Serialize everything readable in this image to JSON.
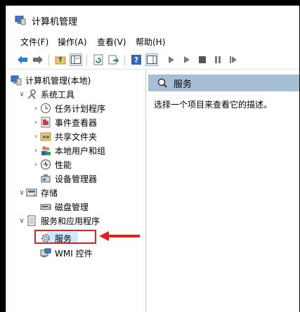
{
  "window": {
    "title": "计算机管理"
  },
  "menu": [
    "文件(F)",
    "操作(A)",
    "查看(V)",
    "帮助(H)"
  ],
  "toolbar": {
    "icons": [
      "back-icon",
      "forward-icon",
      "up-folder-icon",
      "show-hide-tree-icon",
      "refresh-icon",
      "export-icon",
      "help-icon",
      "properties-icon",
      "play-icon",
      "play-alt-icon",
      "stop-icon",
      "pause-icon",
      "restart-icon"
    ]
  },
  "tree": {
    "root": "计算机管理(本地)",
    "system_tools": "系统工具",
    "task_scheduler": "任务计划程序",
    "event_viewer": "事件查看器",
    "shared_folders": "共享文件夹",
    "local_users": "本地用户和组",
    "performance": "性能",
    "device_manager": "设备管理器",
    "storage": "存储",
    "disk_management": "磁盘管理",
    "services_apps": "服务和应用程序",
    "services": "服务",
    "wmi": "WMI 控件"
  },
  "detail": {
    "header": "服务",
    "description": "选择一个项目来查看它的描述。"
  },
  "colors": {
    "header_bg": "#a7bfd6",
    "selection": "#cde8ff",
    "annotation": "#e32020"
  }
}
